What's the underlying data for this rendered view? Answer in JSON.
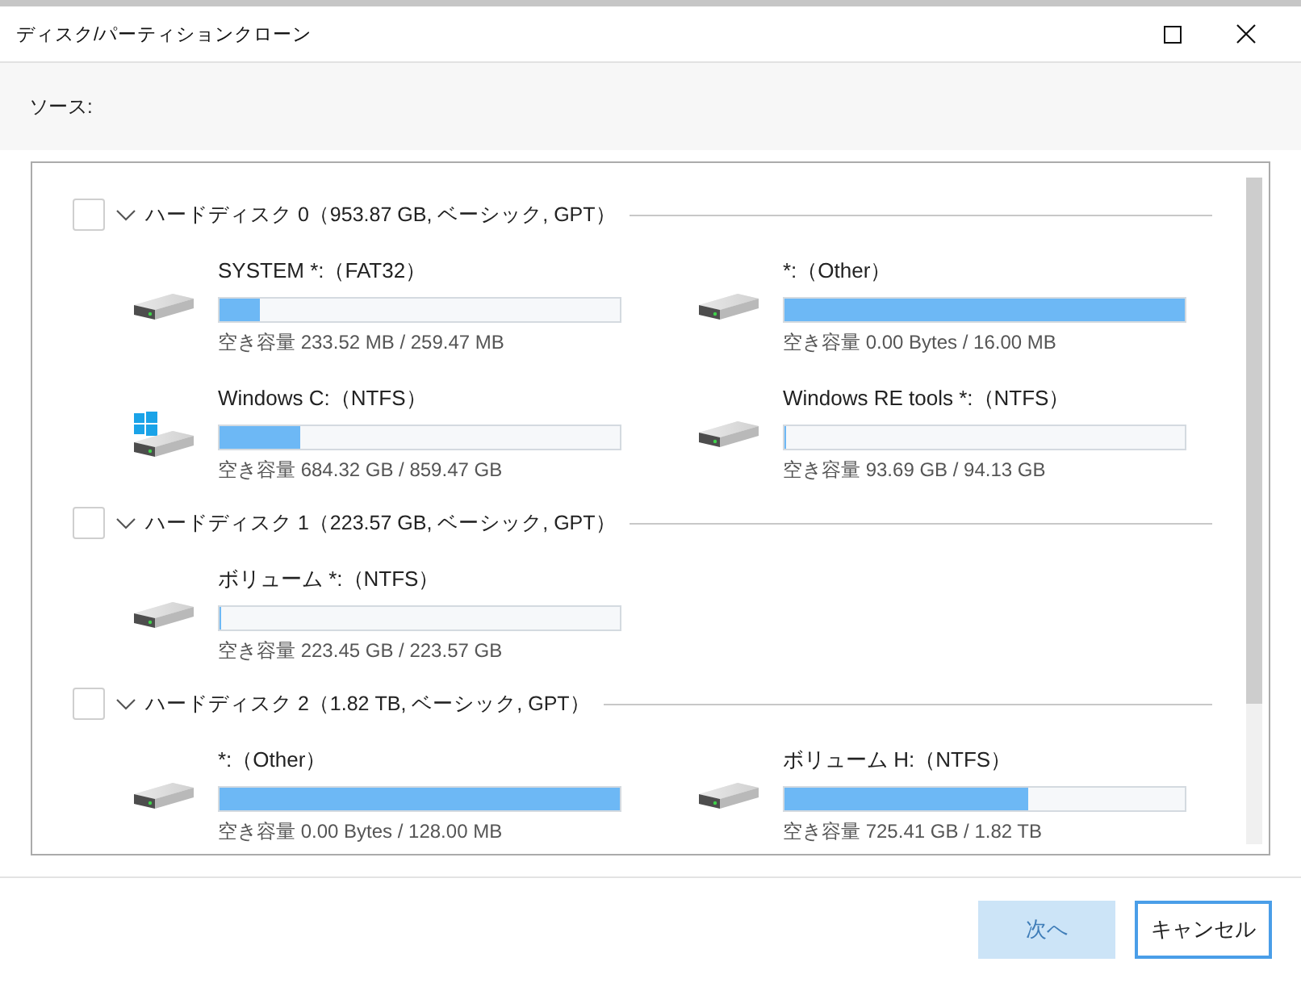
{
  "window": {
    "title": "ディスク/パーティションクローン"
  },
  "source": {
    "label": "ソース:"
  },
  "disks": [
    {
      "label": "ハードディスク 0（953.87 GB, ベーシック, GPT）",
      "checked": false,
      "expanded": true,
      "partitions": [
        {
          "name": "SYSTEM *:（FAT32）",
          "windows": false,
          "level": 0.1,
          "free": "空き容量 233.52 MB / 259.47 MB"
        },
        {
          "name": "*:（Other）",
          "windows": false,
          "level": 1,
          "free": "空き容量 0.00 Bytes / 16.00 MB"
        },
        {
          "name": "Windows C:（NTFS）",
          "windows": true,
          "level": 0.2,
          "free": "空き容量 684.32 GB / 859.47 GB"
        },
        {
          "name": "Windows RE tools *:（NTFS）",
          "windows": false,
          "level": 0.004,
          "free": "空き容量 93.69 GB / 94.13 GB"
        }
      ]
    },
    {
      "label": "ハードディスク 1（223.57 GB, ベーシック, GPT）",
      "checked": false,
      "expanded": true,
      "partitions": [
        {
          "name": "ボリューム *:（NTFS）",
          "windows": false,
          "level": 0.005,
          "free": "空き容量 223.45 GB / 223.57 GB"
        }
      ]
    },
    {
      "label": "ハードディスク 2（1.82 TB, ベーシック, GPT）",
      "checked": false,
      "expanded": true,
      "partitions": [
        {
          "name": "*:（Other）",
          "windows": false,
          "level": 1,
          "free": "空き容量 0.00 Bytes / 128.00 MB"
        },
        {
          "name": "ボリューム H:（NTFS）",
          "windows": false,
          "level": 0.61,
          "free": "空き容量 725.41 GB / 1.82 TB"
        }
      ]
    }
  ],
  "buttons": [
    {
      "label": "次へ",
      "kind": "primary",
      "disabled": true,
      "focused": false
    },
    {
      "label": "キャンセル",
      "kind": "secondary",
      "disabled": false,
      "focused": true
    }
  ]
}
